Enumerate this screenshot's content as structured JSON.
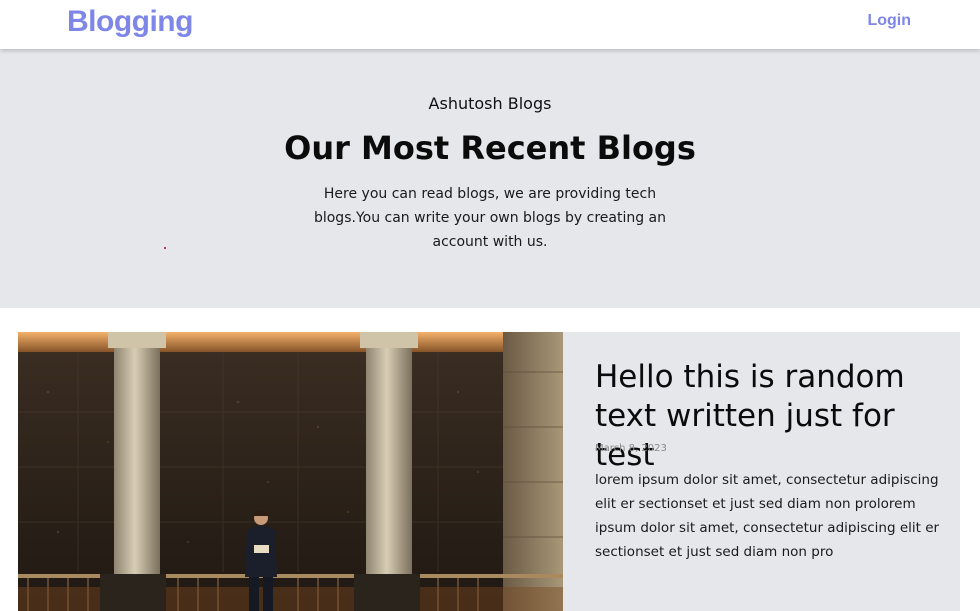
{
  "nav": {
    "brand": "Blogging",
    "login_label": "Login"
  },
  "hero": {
    "eyebrow": "Ashutosh Blogs",
    "title": "Our Most Recent Blogs",
    "description": "Here you can read blogs, we are providing tech blogs.You can write your own blogs by creating an account with us."
  },
  "post": {
    "title": "Hello this is random text written just for test",
    "date": "March 8, 2023",
    "excerpt": "lorem ipsum dolor sit amet, consectetur adipiscing elit er sectionset et just sed diam non prolorem ipsum dolor sit amet, consectetur adipiscing elit er sectionset et just sed diam non pro"
  },
  "colors": {
    "accent": "#7e86e8",
    "hero_bg": "#e6e7eb",
    "card_bg": "#e6e7eb"
  }
}
